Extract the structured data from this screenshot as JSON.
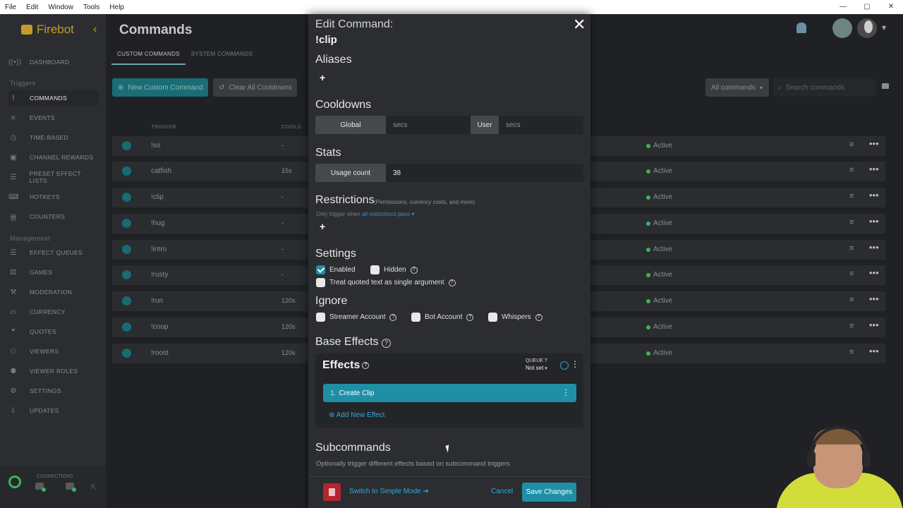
{
  "menubar": {
    "items": [
      "File",
      "Edit",
      "Window",
      "Tools",
      "Help"
    ],
    "controls": [
      "—",
      "▢",
      "✕"
    ]
  },
  "app": {
    "name": "Firebot"
  },
  "sidebar": {
    "items": [
      {
        "label": "DASHBOARD",
        "icon": "broadcast-icon",
        "glyph": "((•))"
      },
      {
        "label": "COMMANDS",
        "icon": "exclamation-icon",
        "glyph": "!"
      },
      {
        "label": "EVENTS",
        "icon": "list-icon",
        "glyph": "≡"
      },
      {
        "label": "TIME-BASED",
        "icon": "clock-icon",
        "glyph": "◷"
      },
      {
        "label": "CHANNEL REWARDS",
        "icon": "rewards-icon",
        "glyph": "▣"
      },
      {
        "label": "PRESET EFFECT LISTS",
        "icon": "list-icon",
        "glyph": "☰"
      },
      {
        "label": "HOTKEYS",
        "icon": "keyboard-icon",
        "glyph": "⌨"
      },
      {
        "label": "COUNTERS",
        "icon": "tally-icon",
        "glyph": "卌"
      },
      {
        "label": "EFFECT QUEUES",
        "icon": "queue-icon",
        "glyph": "☰"
      },
      {
        "label": "GAMES",
        "icon": "dice-icon",
        "glyph": "⚄"
      },
      {
        "label": "MODERATION",
        "icon": "gavel-icon",
        "glyph": "⚒"
      },
      {
        "label": "CURRENCY",
        "icon": "money-icon",
        "glyph": "▭"
      },
      {
        "label": "QUOTES",
        "icon": "quote-icon",
        "glyph": "❝"
      },
      {
        "label": "VIEWERS",
        "icon": "users-icon",
        "glyph": "⚇"
      },
      {
        "label": "VIEWER ROLES",
        "icon": "roles-icon",
        "glyph": "⚉"
      },
      {
        "label": "SETTINGS",
        "icon": "gear-icon",
        "glyph": "⚙"
      },
      {
        "label": "UPDATES",
        "icon": "download-icon",
        "glyph": "⇩"
      }
    ],
    "sections": {
      "triggers": "Triggers",
      "management": "Management"
    },
    "connections_label": "CONNECTIONS"
  },
  "main": {
    "title": "Commands",
    "tabs": [
      "CUSTOM COMMANDS",
      "SYSTEM COMMANDS"
    ],
    "new_button": "New Custom Command",
    "clear_button": "Clear All Cooldowns",
    "filter": "All commands",
    "search_placeholder": "Search commands",
    "columns": {
      "trigger": "TRIGGER",
      "cooldown": "COOLD"
    },
    "rows": [
      {
        "trigger": "!so",
        "cooldown": "-",
        "status": "Active"
      },
      {
        "trigger": "catfish",
        "cooldown": "15s",
        "status": "Active"
      },
      {
        "trigger": "!clip",
        "cooldown": "-",
        "status": "Active"
      },
      {
        "trigger": "!hug",
        "cooldown": "-",
        "status": "Active"
      },
      {
        "trigger": "!intro",
        "cooldown": "-",
        "status": "Active"
      },
      {
        "trigger": "!rusty",
        "cooldown": "-",
        "status": "Active"
      },
      {
        "trigger": "!run",
        "cooldown": "120s",
        "status": "Active"
      },
      {
        "trigger": "!coop",
        "cooldown": "120s",
        "status": "Active"
      },
      {
        "trigger": "!roost",
        "cooldown": "120s",
        "status": "Active"
      }
    ]
  },
  "modal": {
    "title": "Edit Command:",
    "command": "!clip",
    "aliases": "Aliases",
    "cooldowns": {
      "heading": "Cooldowns",
      "global": "Global",
      "user": "User",
      "global_placeholder": "secs",
      "user_placeholder": "secs"
    },
    "stats": {
      "heading": "Stats",
      "usage_label": "Usage count",
      "usage_value": "38"
    },
    "restrictions": {
      "heading": "Restrictions",
      "sub": "(Permissions, currency costs, and more)",
      "note_prefix": "Only trigger when",
      "note_link": "all restrictions pass"
    },
    "settings": {
      "heading": "Settings",
      "enabled": "Enabled",
      "hidden": "Hidden",
      "quoted": "Treat quoted text as single argument"
    },
    "ignore": {
      "heading": "Ignore",
      "streamer": "Streamer Account",
      "bot": "Bot Account",
      "whispers": "Whispers"
    },
    "base_effects": "Base Effects",
    "effects": {
      "heading": "Effects",
      "queue_label": "QUEUE",
      "queue_value": "Not set",
      "item_number": "1.",
      "item_label": "Create Clip",
      "add": "Add New Effect"
    },
    "subcommands": {
      "heading": "Subcommands",
      "note": "Optionally trigger different effects based on subcommand triggers"
    },
    "footer": {
      "simple": "Switch to Simple Mode",
      "cancel": "Cancel",
      "save": "Save Changes"
    }
  }
}
